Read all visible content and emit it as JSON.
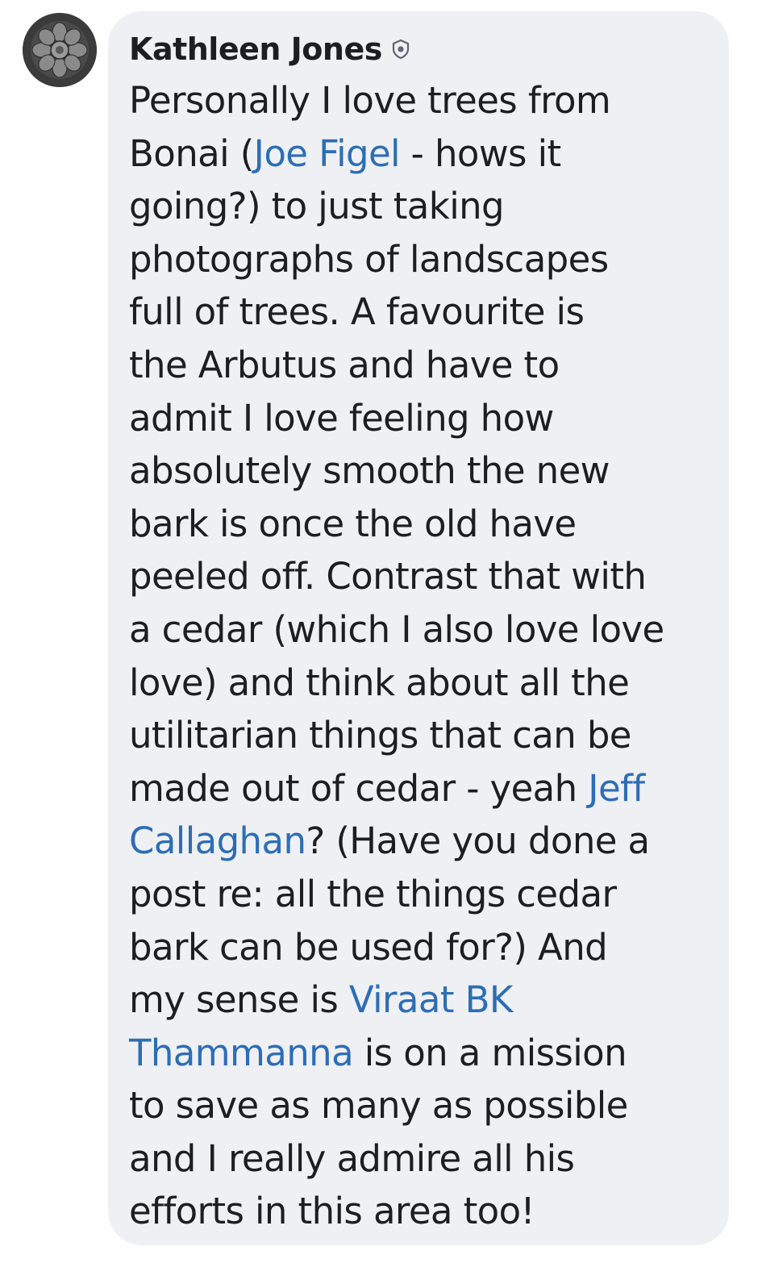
{
  "comment": {
    "author": "Kathleen Jones",
    "badge_icon": "shield-badge-icon",
    "avatar_icon": "rosette-medallion-avatar",
    "text_color": "#1c1e21",
    "mention_color": "#2d6db5",
    "bubble_color": "#eef0f3",
    "lines": [
      [
        {
          "t": "Personally I love trees from"
        }
      ],
      [
        {
          "t": "Bonai ("
        },
        {
          "t": "Joe Figel",
          "mention": true
        },
        {
          "t": " - hows it"
        }
      ],
      [
        {
          "t": "going?) to just taking"
        }
      ],
      [
        {
          "t": "photographs of landscapes"
        }
      ],
      [
        {
          "t": "full of trees.  A favourite is"
        }
      ],
      [
        {
          "t": "the Arbutus and have to"
        }
      ],
      [
        {
          "t": "admit I love feeling how"
        }
      ],
      [
        {
          "t": "absolutely smooth the new"
        }
      ],
      [
        {
          "t": "bark is once the old have"
        }
      ],
      [
        {
          "t": "peeled off.  Contrast that with"
        }
      ],
      [
        {
          "t": "a cedar (which I also love love"
        }
      ],
      [
        {
          "t": "love) and think about all the"
        }
      ],
      [
        {
          "t": "utilitarian things that can be"
        }
      ],
      [
        {
          "t": "made out of cedar - yeah "
        },
        {
          "t": "Jeff",
          "mention": true
        }
      ],
      [
        {
          "t": "Callaghan",
          "mention": true
        },
        {
          "t": "? (Have you done a"
        }
      ],
      [
        {
          "t": "post re: all the things cedar"
        }
      ],
      [
        {
          "t": "bark can be used for?)  And"
        }
      ],
      [
        {
          "t": "my sense is "
        },
        {
          "t": "Viraat BK",
          "mention": true
        }
      ],
      [
        {
          "t": "Thammanna",
          "mention": true
        },
        {
          "t": " is on a mission"
        }
      ],
      [
        {
          "t": "to save as many as possible"
        }
      ],
      [
        {
          "t": "and I really admire all his"
        }
      ],
      [
        {
          "t": "efforts in this area too!"
        }
      ]
    ]
  }
}
